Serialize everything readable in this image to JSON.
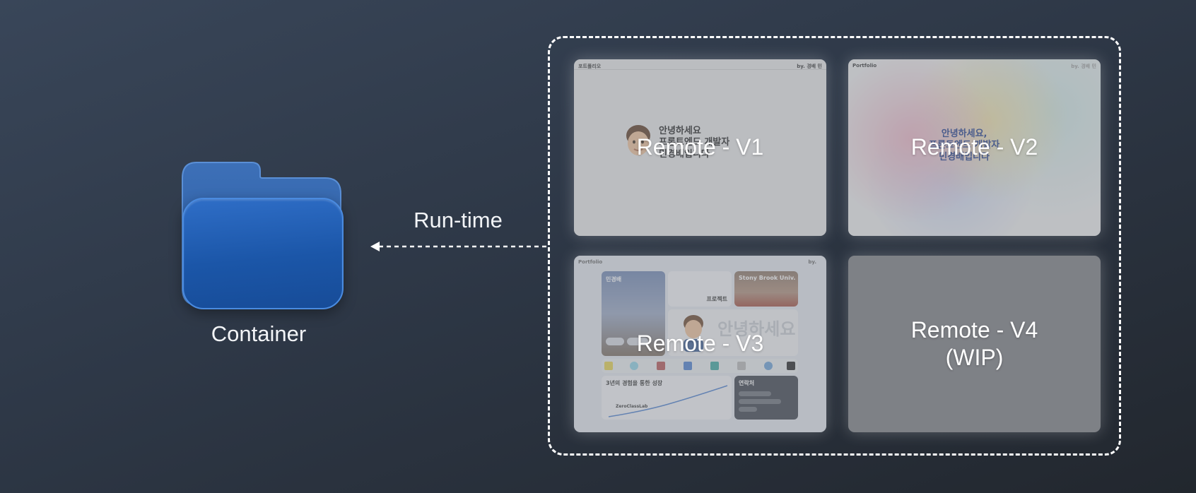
{
  "container": {
    "label": "Container"
  },
  "arrow": {
    "label": "Run-time"
  },
  "remotes": [
    {
      "label": "Remote - V1",
      "thumb_top_left": "포트폴리오",
      "thumb_top_right": "by. 경배 민",
      "thumb_lines": [
        "안녕하세요",
        "프론트엔드 개발자",
        "민경배입니다"
      ]
    },
    {
      "label": "Remote - V2",
      "thumb_top_left": "Portfolio",
      "thumb_top_right": "by. 경배 민",
      "thumb_lines": [
        "안녕하세요,",
        "프론트엔드 개발자",
        "민경배입니다"
      ]
    },
    {
      "label": "Remote - V3",
      "thumb_top_left": "Portfolio",
      "thumb_top_right": "by.",
      "thumb_tiles": {
        "name": "민경배",
        "project": "프로젝트",
        "school": "Stony Brook Univ.",
        "hello": "안녕하세요",
        "growth": "3년의 경험을 통한 성장",
        "company": "ZeroClassLab",
        "contact": "연락처"
      }
    },
    {
      "label": "Remote - V4",
      "label_sub": "(WIP)"
    }
  ],
  "colors": {
    "folder_blue": "#1b56a8",
    "dashed_border": "#ffffff",
    "v2_accent": "#1d3a8a"
  }
}
